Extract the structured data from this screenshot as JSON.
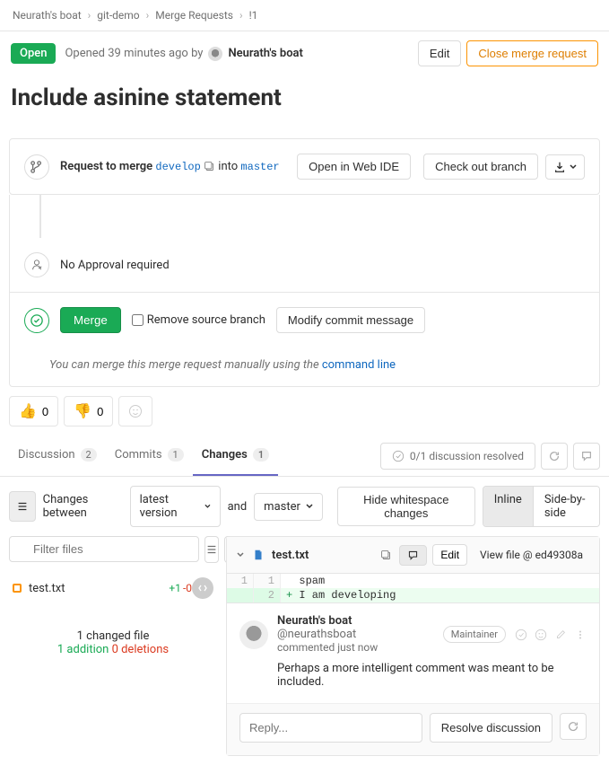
{
  "breadcrumbs": {
    "b1": "Neurath's boat",
    "b2": "git-demo",
    "b3": "Merge Requests",
    "b4": "!1"
  },
  "header": {
    "status": "Open",
    "opened_text": "Opened 39 minutes ago by",
    "author": "Neurath's boat",
    "edit": "Edit",
    "close": "Close merge request"
  },
  "title": "Include asinine statement",
  "merge_widget": {
    "request_label": "Request to merge",
    "source_branch": "develop",
    "into": "into",
    "target_branch": "master",
    "open_ide": "Open in Web IDE",
    "checkout": "Check out branch",
    "approval": "No Approval required",
    "merge_btn": "Merge",
    "remove_branch": "Remove source branch",
    "modify_commit": "Modify commit message",
    "manual_text": "You can merge this merge request manually using the ",
    "command_line": "command line"
  },
  "reactions": {
    "thumbs_up": "0",
    "thumbs_down": "0"
  },
  "tabs": {
    "discussion": "Discussion",
    "discussion_count": "2",
    "commits": "Commits",
    "commits_count": "1",
    "changes": "Changes",
    "changes_count": "1",
    "resolved": "0/1 discussion resolved"
  },
  "diff_controls": {
    "changes_between": "Changes between",
    "latest_version": "latest version",
    "and": "and",
    "master": "master",
    "hide_ws": "Hide whitespace changes",
    "inline": "Inline",
    "sidebyside": "Side-by-side"
  },
  "files": {
    "filter_placeholder": "Filter files",
    "file1": "test.txt",
    "file1_add": "+1",
    "file1_del": "-0",
    "summary_count": "1 changed file",
    "summary_adds": "1 addition",
    "summary_dels": "0 deletions"
  },
  "diff": {
    "filename": "test.txt",
    "edit": "Edit",
    "view_file": "View file @ ed49308a",
    "line1_old": "1",
    "line1_new": "1",
    "line1_content": "spam",
    "line2_new": "2",
    "line2_content": "I am developing"
  },
  "discussion": {
    "author": "Neurath's boat",
    "handle": "@neurathsboat",
    "time": "commented just now",
    "role": "Maintainer",
    "body": "Perhaps a more intelligent comment was meant to be included.",
    "reply_placeholder": "Reply...",
    "resolve": "Resolve discussion"
  }
}
